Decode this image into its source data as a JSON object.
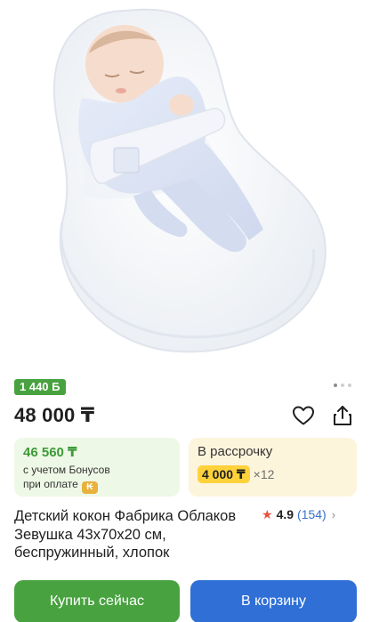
{
  "product": {
    "image_alt": "Детский кокон с младенцем",
    "bonus_badge": "1 440 Б",
    "price": "48 000 ₸",
    "title": "Детский кокон Фабрика Облаков Зевушка 43х70х20 см, беспружинный, хлопок"
  },
  "gallery": {
    "dots_total": 3,
    "active_index": 0
  },
  "bonus_card": {
    "price": "46 560 ₸",
    "note_line1": "с учетом Бонусов",
    "note_line2": "при оплате",
    "coin_icon": "kaspi-coin-icon"
  },
  "installment_card": {
    "title": "В рассрочку",
    "amount": "4 000 ₸",
    "multiplier": "×12"
  },
  "rating": {
    "score": "4.9",
    "count": "(154)"
  },
  "actions": {
    "buy_now": "Купить сейчас",
    "add_to_cart": "В корзину",
    "favorite_icon": "heart-icon",
    "share_icon": "share-icon"
  },
  "colors": {
    "brand_green": "#48a23f",
    "brand_blue": "#2f6fd6",
    "installment_yellow": "#ffd23c",
    "star_red": "#e8513c"
  }
}
